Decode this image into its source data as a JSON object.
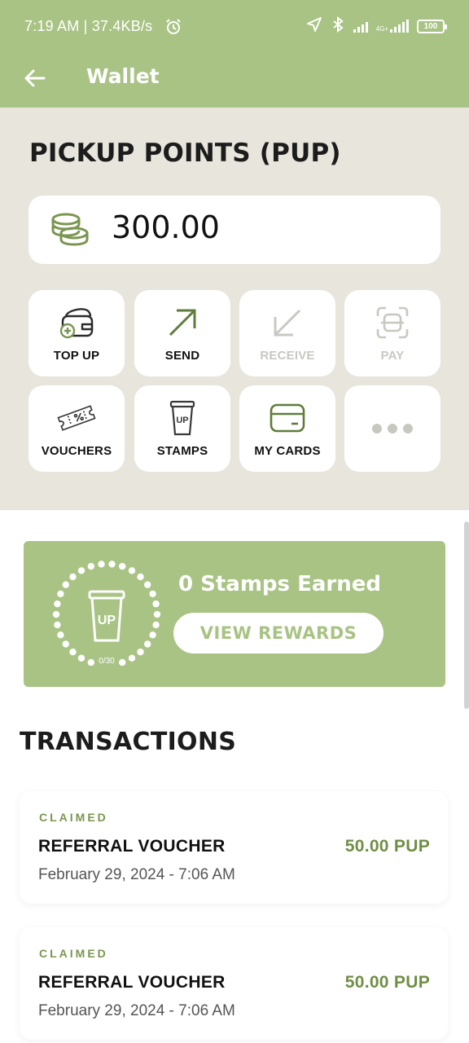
{
  "status_bar": {
    "time": "7:19 AM | 37.4KB/s",
    "network_type": "4G+",
    "battery": "100",
    "icons": [
      "alarm-icon",
      "location-icon",
      "bluetooth-icon",
      "signal-icon",
      "signal-icon",
      "battery-icon"
    ]
  },
  "app_bar": {
    "title": "Wallet",
    "back_icon": "arrow-left-icon"
  },
  "wallet": {
    "section_title": "PICKUP POINTS (PUP)",
    "balance": "300.00",
    "balance_icon": "coins-icon"
  },
  "actions": [
    {
      "label": "TOP UP",
      "icon": "wallet-plus-icon",
      "enabled": true
    },
    {
      "label": "SEND",
      "icon": "arrow-up-right-icon",
      "enabled": true
    },
    {
      "label": "RECEIVE",
      "icon": "arrow-down-left-icon",
      "enabled": false
    },
    {
      "label": "PAY",
      "icon": "scan-icon",
      "enabled": false
    },
    {
      "label": "VOUCHERS",
      "icon": "voucher-icon",
      "enabled": true
    },
    {
      "label": "STAMPS",
      "icon": "coffee-cup-icon",
      "enabled": true
    },
    {
      "label": "MY CARDS",
      "icon": "card-icon",
      "enabled": true
    },
    {
      "label": "",
      "icon": "more-icon",
      "enabled": true
    }
  ],
  "stamps": {
    "earned_text": "0 Stamps Earned",
    "progress": "0/30",
    "button_label": "VIEW REWARDS",
    "cup_logo": "UP"
  },
  "transactions": {
    "title": "TRANSACTIONS",
    "items": [
      {
        "status": "CLAIMED",
        "name": "REFERRAL VOUCHER",
        "date": "February 29, 2024 - 7:06 AM",
        "amount": "50.00 PUP"
      },
      {
        "status": "CLAIMED",
        "name": "REFERRAL VOUCHER",
        "date": "February 29, 2024 - 7:06 AM",
        "amount": "50.00 PUP"
      }
    ]
  },
  "colors": {
    "brand_green": "#a8c384",
    "dark_green": "#6f8f44",
    "section_bg": "#e8e5dc",
    "disabled": "#c7c8c0"
  }
}
